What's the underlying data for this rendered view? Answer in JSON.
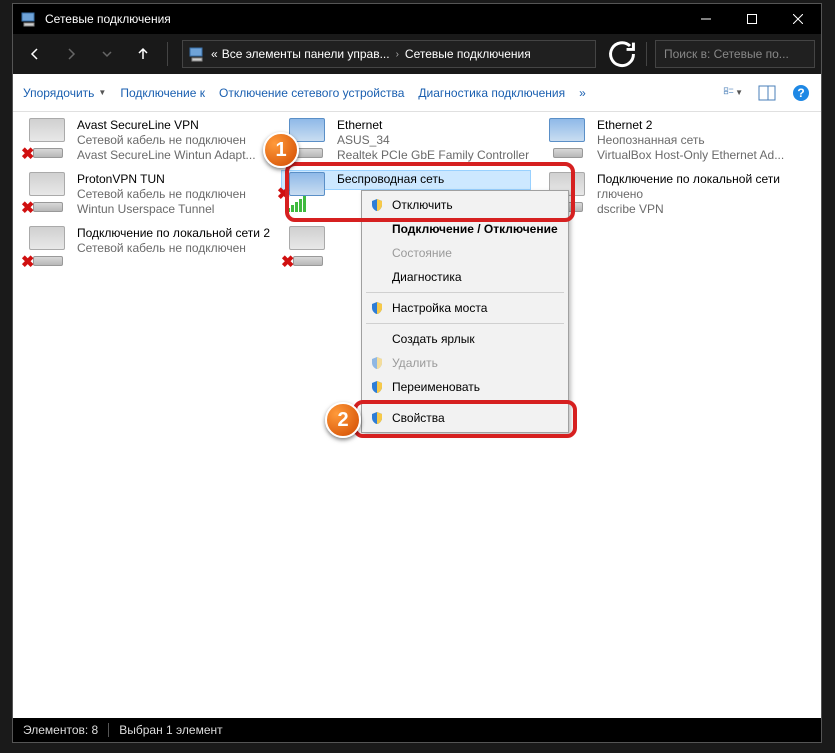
{
  "window": {
    "title": "Сетевые подключения"
  },
  "address": {
    "seg1": "Все элементы панели управ...",
    "seg2": "Сетевые подключения"
  },
  "search": {
    "placeholder": "Поиск в: Сетевые по..."
  },
  "toolbar": {
    "organize": "Упорядочить",
    "connect": "Подключение к",
    "disable": "Отключение сетевого устройства",
    "diagnose": "Диагностика подключения"
  },
  "connections": [
    {
      "name": "Avast SecureLine VPN",
      "line2": "Сетевой кабель не подключен",
      "line3": "Avast SecureLine Wintun Adapt..."
    },
    {
      "name": "Ethernet",
      "line2": "ASUS_34",
      "line3": "Realtek PCIe GbE Family Controller"
    },
    {
      "name": "Ethernet 2",
      "line2": "Неопознанная сеть",
      "line3": "VirtualBox Host-Only Ethernet Ad..."
    },
    {
      "name": "ProtonVPN TUN",
      "line2": "Сетевой кабель не подключен",
      "line3": "Wintun Userspace Tunnel"
    },
    {
      "name": "Беспроводная сеть",
      "line2": "",
      "line3": ""
    },
    {
      "name": "Подключение по локальной сети",
      "line2": "глючено",
      "line3": "dscribe VPN"
    },
    {
      "name": "Подключение по локальной сети 2",
      "line2": "Сетевой кабель не подключен",
      "line3": ""
    }
  ],
  "context_menu": [
    {
      "label": "Отключить",
      "shield": true
    },
    {
      "label": "Подключение / Отключение",
      "bold": true
    },
    {
      "label": "Состояние",
      "disabled": true
    },
    {
      "label": "Диагностика"
    },
    {
      "sep": true
    },
    {
      "label": "Настройка моста",
      "shield": true
    },
    {
      "sep": true
    },
    {
      "label": "Создать ярлык"
    },
    {
      "label": "Удалить",
      "shield": true,
      "disabled": true
    },
    {
      "label": "Переименовать",
      "shield": true
    },
    {
      "sep": true
    },
    {
      "label": "Свойства",
      "shield": true
    }
  ],
  "status": {
    "count": "Элементов: 8",
    "selected": "Выбран 1 элемент"
  },
  "badges": {
    "b1": "1",
    "b2": "2"
  }
}
